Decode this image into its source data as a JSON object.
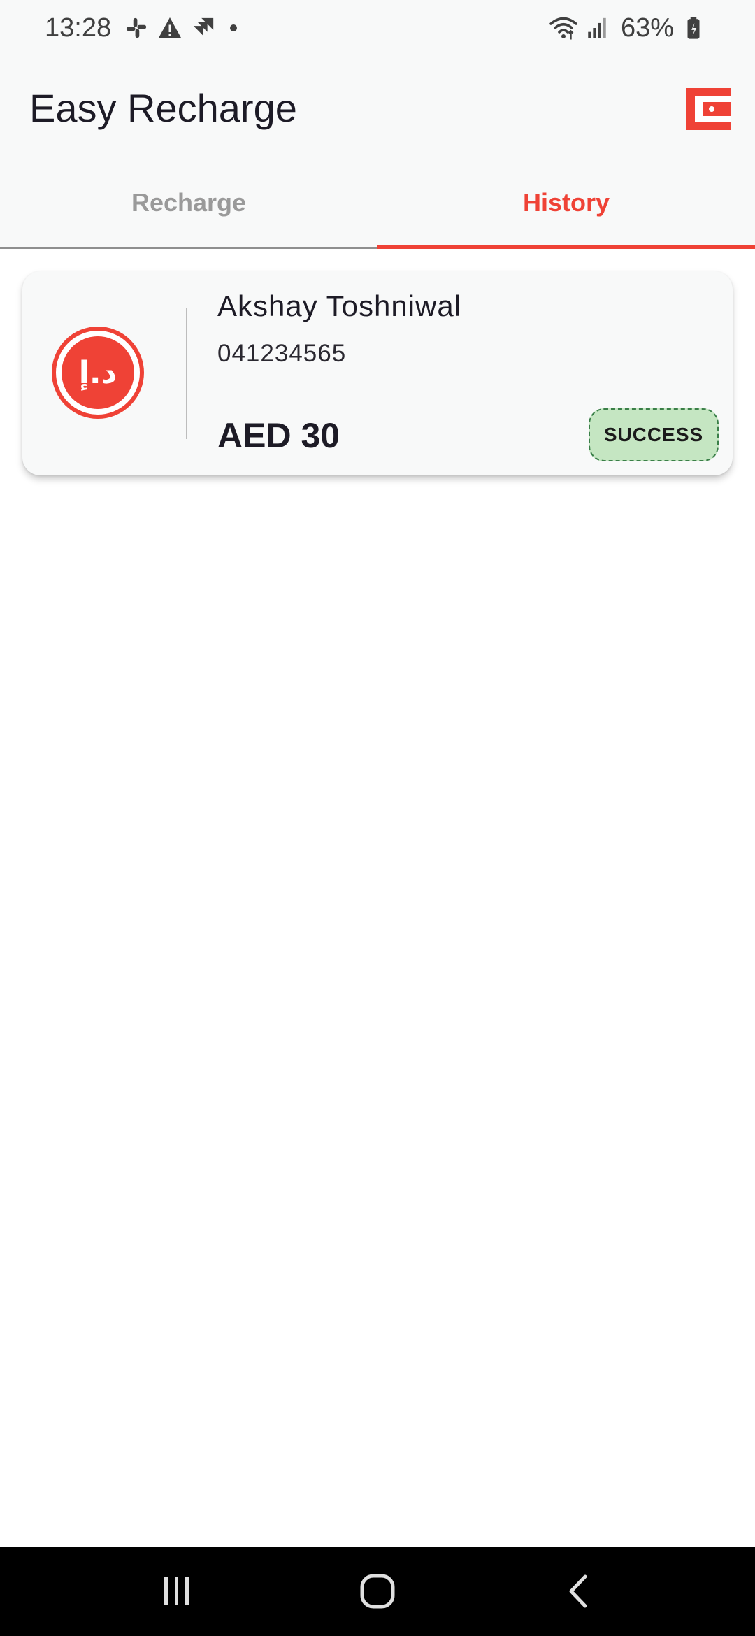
{
  "status_bar": {
    "time": "13:28",
    "battery_percent": "63%",
    "left_icons": [
      "slack-icon",
      "warning-icon",
      "jira-icon",
      "notification-dot-icon"
    ],
    "right_icons": [
      "wifi-icon",
      "signal-icon",
      "battery-icon"
    ]
  },
  "app_bar": {
    "title": "Easy Recharge",
    "action_icon": "wallet-icon"
  },
  "tabs": [
    {
      "label": "Recharge",
      "active": false
    },
    {
      "label": "History",
      "active": true
    }
  ],
  "history": [
    {
      "currency_symbol": "د.إ",
      "name": "Akshay Toshniwal",
      "phone": "041234565",
      "amount": "AED 30",
      "status": "SUCCESS"
    }
  ],
  "colors": {
    "accent": "#ef4236",
    "success_bg": "#c5e6c2",
    "success_border": "#3a7f48"
  },
  "nav_bar": {
    "buttons": [
      "recent-apps-icon",
      "home-icon",
      "back-icon"
    ]
  }
}
